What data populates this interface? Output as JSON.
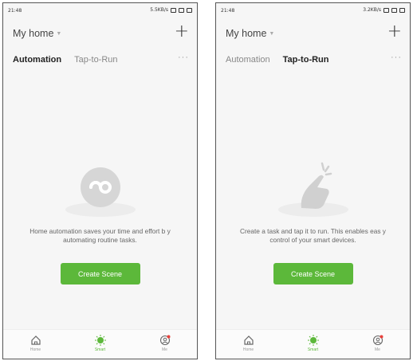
{
  "screens": [
    {
      "status": {
        "time": "21:48",
        "right": "5.5KB/s"
      },
      "home_title": "My home",
      "plus": "+",
      "tabs": [
        "Automation",
        "Tap-to-Run"
      ],
      "active_tab": 0,
      "more": "···",
      "description": "Home automation saves your time and effort b y automating routine tasks.",
      "button": "Create Scene",
      "tabbar": [
        {
          "label": "Home",
          "icon": "home-icon"
        },
        {
          "label": "Smart",
          "icon": "smart-sun-icon"
        },
        {
          "label": "Me",
          "icon": "me-icon"
        }
      ]
    },
    {
      "status": {
        "time": "21:48",
        "right": "3.2KB/s"
      },
      "home_title": "My home",
      "plus": "+",
      "tabs": [
        "Automation",
        "Tap-to-Run"
      ],
      "active_tab": 1,
      "more": "···",
      "description": "Create a task and tap it to run. This enables eas y control of your smart devices.",
      "button": "Create Scene",
      "tabbar": [
        {
          "label": "Home",
          "icon": "home-icon"
        },
        {
          "label": "Smart",
          "icon": "smart-sun-icon"
        },
        {
          "label": "Me",
          "icon": "me-icon"
        }
      ]
    }
  ],
  "colors": {
    "accent": "#5cb83a",
    "badge": "#e8413c"
  }
}
